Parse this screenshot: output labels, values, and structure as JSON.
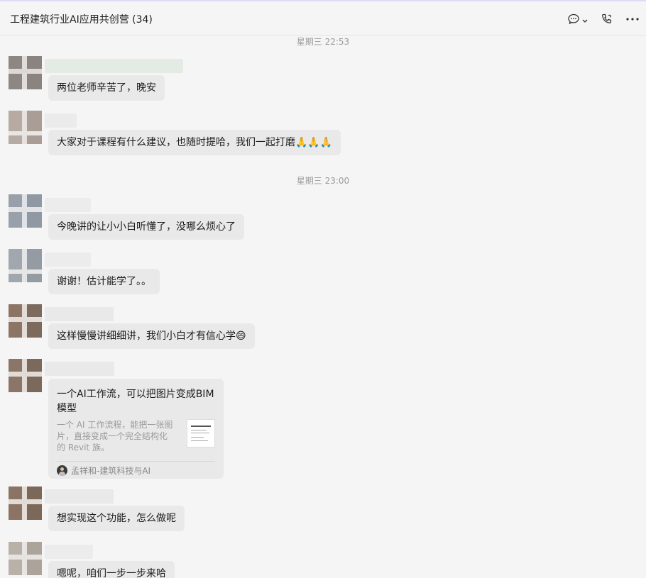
{
  "header": {
    "title": "工程建筑行业AI应用共创营 (34)",
    "icons": [
      "chat-bubble-icon",
      "chevron-down-icon",
      "phone-icon",
      "more-icon"
    ]
  },
  "timestamps": [
    "星期三 22:53",
    "星期三 23:00"
  ],
  "messages": [
    {
      "text": "两位老师辛苦了，晚安"
    },
    {
      "text": "大家对于课程有什么建议，也随时提哈，我们一起打磨",
      "emoji": "🙏🙏🙏"
    },
    {
      "text": "今晚讲的让小小白听懂了，没哪么烦心了"
    },
    {
      "text": "谢谢！估计能学了。。"
    },
    {
      "text": "这样慢慢讲细细讲，我们小白才有信心学",
      "emoji": "😄"
    },
    {
      "text": "想实现这个功能，怎么做呢"
    },
    {
      "text": "嗯呢，咱们一步一步来哈"
    }
  ],
  "card": {
    "title": "一个AI工作流，可以把图片变成BIM模型",
    "description": "一个 AI 工作流程，能把一张图片，直接变成一个完全结构化的 Revit 族。",
    "source": "孟祥和-建筑科技与AI"
  },
  "colors": {
    "bubble": "#e9e9e9",
    "background": "#f5f5f5",
    "timestamp": "#9a9a9a"
  }
}
